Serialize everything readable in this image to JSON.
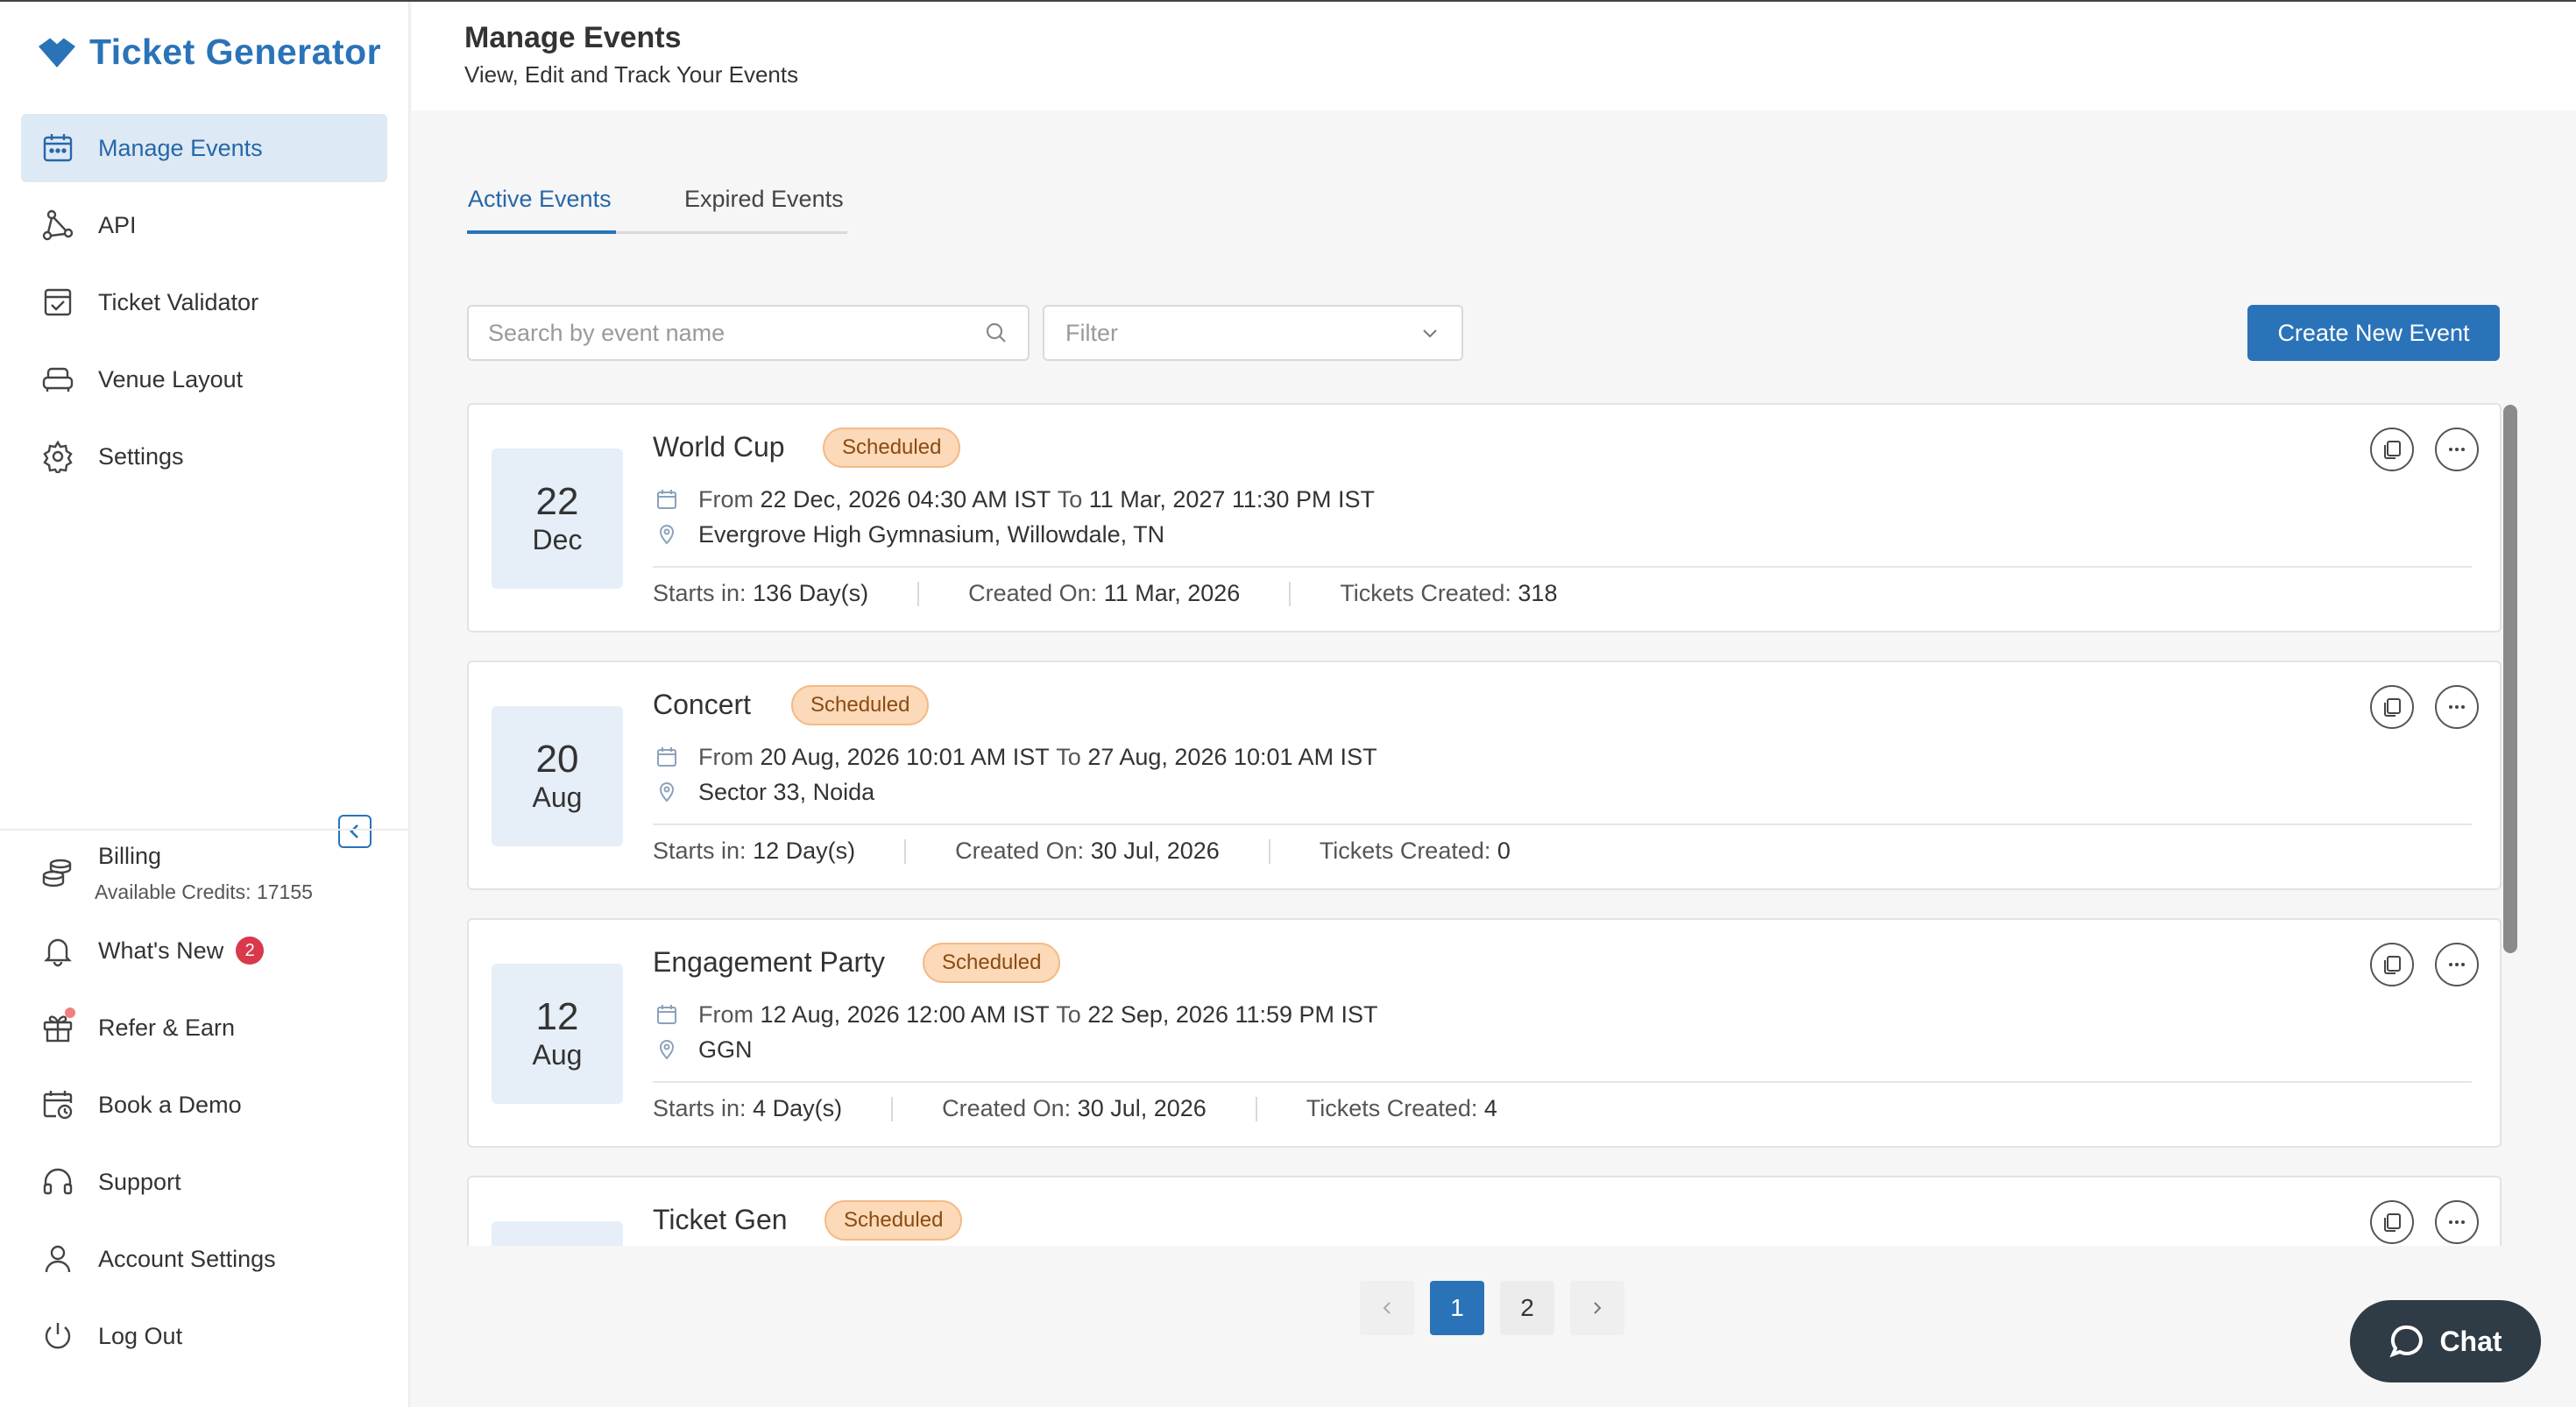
{
  "app": {
    "name": "Ticket Generator"
  },
  "sidebar": {
    "items": [
      {
        "label": "Manage Events",
        "icon": "calendar-icon"
      },
      {
        "label": "API",
        "icon": "api-icon"
      },
      {
        "label": "Ticket Validator",
        "icon": "ticket-validator-icon"
      },
      {
        "label": "Venue Layout",
        "icon": "sofa-icon"
      },
      {
        "label": "Settings",
        "icon": "gear-icon"
      }
    ],
    "bottom": {
      "billing": {
        "label": "Billing",
        "sub": "Available Credits: 17155"
      },
      "whats_new": {
        "label": "What's New",
        "count": "2"
      },
      "refer": {
        "label": "Refer & Earn"
      },
      "demo": {
        "label": "Book a Demo"
      },
      "support": {
        "label": "Support"
      },
      "account": {
        "label": "Account Settings"
      },
      "logout": {
        "label": "Log Out"
      }
    }
  },
  "header": {
    "title": "Manage Events",
    "subtitle": "View, Edit and Track Your Events"
  },
  "tabs": [
    {
      "label": "Active Events",
      "active": true
    },
    {
      "label": "Expired Events",
      "active": false
    }
  ],
  "toolbar": {
    "search_placeholder": "Search by event name",
    "filter_placeholder": "Filter",
    "create_label": "Create New Event"
  },
  "labels": {
    "from": "From",
    "to": "To",
    "starts_in": "Starts in:",
    "created_on": "Created On:",
    "tickets_created": "Tickets Created:"
  },
  "events": [
    {
      "day": "22",
      "month": "Dec",
      "name": "World Cup",
      "status": "Scheduled",
      "from": "22 Dec, 2026 04:30 AM IST",
      "to": "11 Mar, 2027 11:30 PM IST",
      "location": "Evergrove High Gymnasium, Willowdale, TN",
      "starts_in": "136 Day(s)",
      "created_on": "11 Mar, 2026",
      "tickets": "318"
    },
    {
      "day": "20",
      "month": "Aug",
      "name": "Concert",
      "status": "Scheduled",
      "from": "20 Aug, 2026 10:01 AM IST",
      "to": "27 Aug, 2026 10:01 AM IST",
      "location": "Sector 33, Noida",
      "starts_in": "12 Day(s)",
      "created_on": "30 Jul, 2026",
      "tickets": "0"
    },
    {
      "day": "12",
      "month": "Aug",
      "name": "Engagement Party",
      "status": "Scheduled",
      "from": "12 Aug, 2026 12:00 AM IST",
      "to": "22 Sep, 2026 11:59 PM IST",
      "location": "GGN",
      "starts_in": "4 Day(s)",
      "created_on": "30 Jul, 2026",
      "tickets": "4"
    },
    {
      "name": "Ticket Gen",
      "status": "Scheduled"
    }
  ],
  "pagination": {
    "pages": [
      "1",
      "2"
    ],
    "current": "1"
  },
  "chat": {
    "label": "Chat"
  },
  "colors": {
    "accent": "#2a73b8",
    "status_bg": "#fcd9b8",
    "badge_red": "#d9394a",
    "chat_bg": "#2f3b45"
  }
}
